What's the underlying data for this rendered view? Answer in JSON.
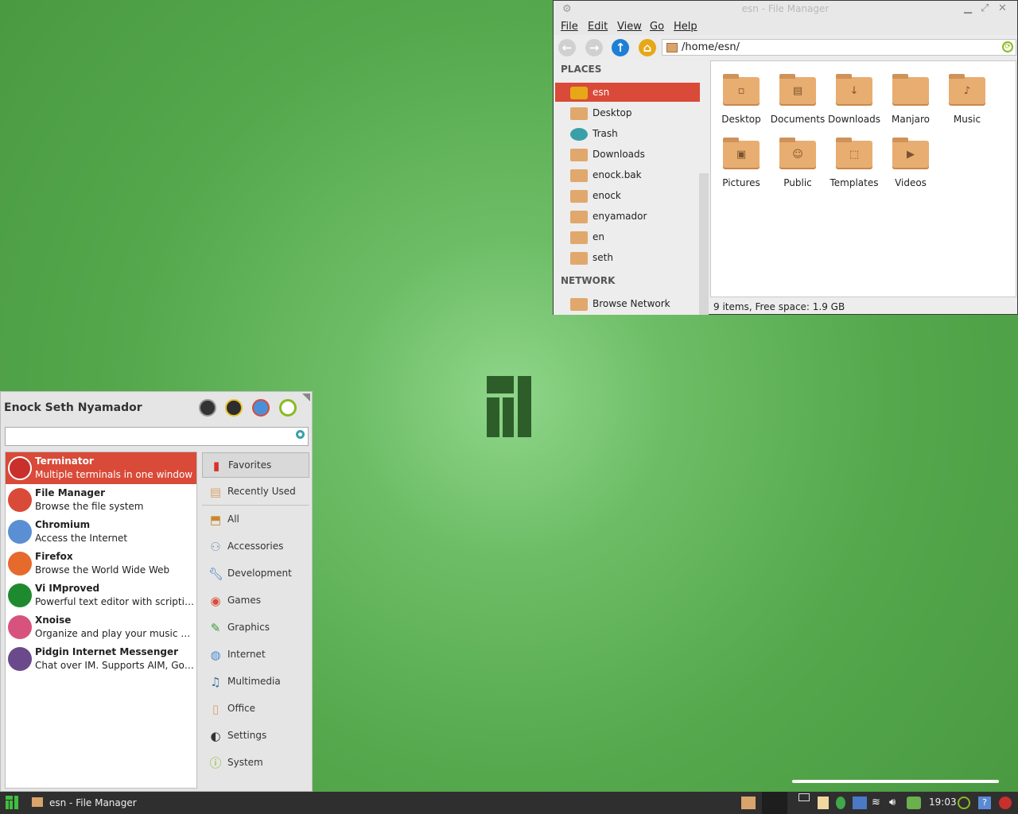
{
  "file_manager": {
    "title": "esn - File Manager",
    "menu": [
      "File",
      "Edit",
      "View",
      "Go",
      "Help"
    ],
    "location": "/home/esn/",
    "places_header": "PLACES",
    "places": [
      "esn",
      "Desktop",
      "Trash",
      "Downloads",
      "enock.bak",
      "enock",
      "enyamador",
      "en",
      "seth"
    ],
    "network_header": "NETWORK",
    "network": [
      "Browse Network"
    ],
    "folders": [
      "Desktop",
      "Documents",
      "Downloads",
      "Manjaro",
      "Music",
      "Pictures",
      "Public",
      "Templates",
      "Videos"
    ],
    "status": "9 items, Free space: 1.9 GB"
  },
  "whisker": {
    "user": "Enock Seth Nyamador",
    "search_placeholder": "",
    "apps": [
      {
        "name": "Terminator",
        "desc": "Multiple terminals in one window"
      },
      {
        "name": "File Manager",
        "desc": "Browse the file system"
      },
      {
        "name": "Chromium",
        "desc": "Access the Internet"
      },
      {
        "name": "Firefox",
        "desc": "Browse the World Wide Web"
      },
      {
        "name": "Vi IMproved",
        "desc": "Powerful text editor with scripting …"
      },
      {
        "name": "Xnoise",
        "desc": "Organize and play your music and…"
      },
      {
        "name": "Pidgin Internet Messenger",
        "desc": "Chat over IM.  Supports AIM, Googl…"
      }
    ],
    "categories": [
      "Favorites",
      "Recently Used",
      "All",
      "Accessories",
      "Development",
      "Games",
      "Graphics",
      "Internet",
      "Multimedia",
      "Office",
      "Settings",
      "System"
    ]
  },
  "taskbar": {
    "task": "esn - File Manager",
    "clock": "19:03"
  },
  "colors": {
    "accent": "#d94a38",
    "desktop": "#5aad52",
    "folder": "#e8ad70"
  }
}
